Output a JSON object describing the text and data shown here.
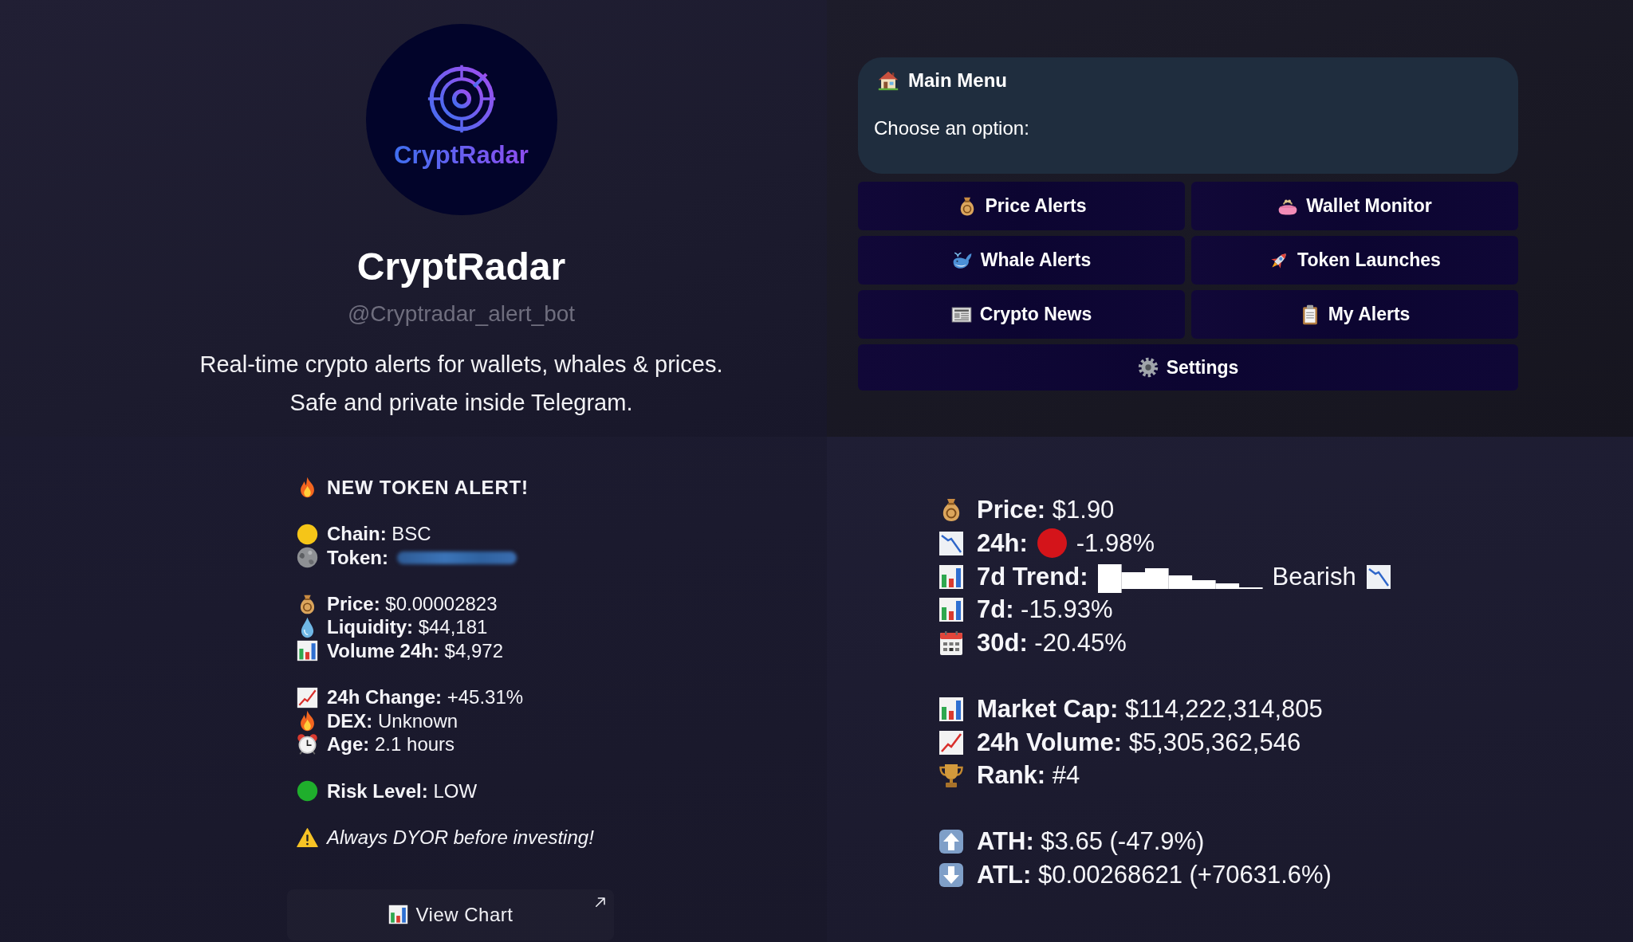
{
  "profile": {
    "logo_text": "CryptRadar",
    "name": "CryptRadar",
    "handle": "@Cryptradar_alert_bot",
    "description": [
      "Real-time crypto alerts for wallets, whales & prices.",
      "Safe and private inside Telegram."
    ]
  },
  "menu": {
    "title": "Main Menu",
    "prompt": "Choose an option:",
    "buttons": [
      "Price Alerts",
      "Wallet Monitor",
      "Whale Alerts",
      "Token Launches",
      "Crypto News",
      "My Alerts",
      "Settings"
    ]
  },
  "token_alert": {
    "heading": "NEW TOKEN ALERT!",
    "groups": [
      [
        {
          "kind": "dot",
          "label": "Chain:",
          "value": "BSC",
          "color": "#f5c518"
        },
        {
          "kind": "redacted",
          "label": "Token:"
        }
      ],
      [
        {
          "kind": "text",
          "label": "Price:",
          "value": "$0.00002823"
        },
        {
          "kind": "text",
          "label": "Liquidity:",
          "value": "$44,181"
        },
        {
          "kind": "text",
          "label": "Volume 24h:",
          "value": "$4,972"
        }
      ],
      [
        {
          "kind": "text",
          "label": "24h Change:",
          "value": "+45.31%"
        },
        {
          "kind": "text",
          "label": "DEX:",
          "value": "Unknown"
        },
        {
          "kind": "text",
          "label": "Age:",
          "value": "2.1 hours"
        }
      ],
      [
        {
          "kind": "dot",
          "label": "Risk Level:",
          "value": "LOW",
          "color": "#1fae2c"
        }
      ]
    ],
    "note": "Always DYOR before investing!",
    "button": "View Chart"
  },
  "market": {
    "groups": [
      [
        {
          "kind": "text",
          "label": "Price:",
          "value": "$1.90"
        },
        {
          "kind": "dot",
          "label": "24h:",
          "value": "-1.98%",
          "color": "#d4141a"
        },
        {
          "kind": "trend",
          "label": "7d Trend:",
          "value": "Bearish"
        },
        {
          "kind": "text",
          "label": "7d:",
          "value": "-15.93%"
        },
        {
          "kind": "text",
          "label": "30d:",
          "value": "-20.45%"
        }
      ],
      [
        {
          "kind": "text",
          "label": "Market Cap:",
          "value": "$114,222,314,805"
        },
        {
          "kind": "text",
          "label": "24h Volume:",
          "value": "$5,305,362,546"
        },
        {
          "kind": "text",
          "label": "Rank:",
          "value": "#4"
        }
      ],
      [
        {
          "kind": "text",
          "label": "ATH:",
          "value": "$3.65 (-47.9%)"
        },
        {
          "kind": "text",
          "label": "ATL:",
          "value": "$0.00268621 (+70631.6%)"
        }
      ]
    ]
  }
}
